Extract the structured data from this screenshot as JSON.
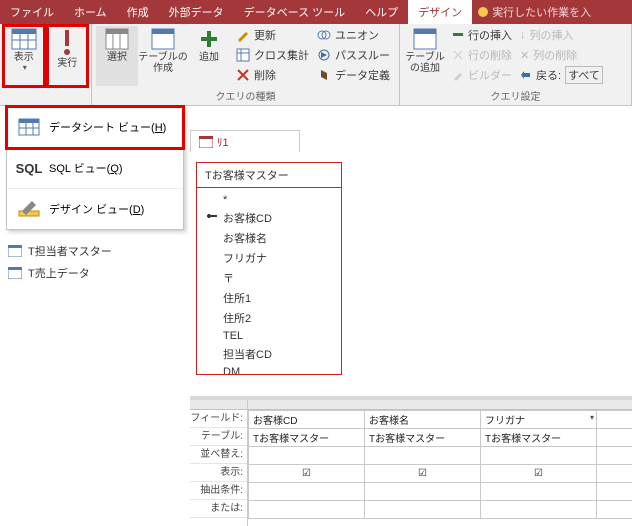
{
  "menu": {
    "file": "ファイル",
    "home": "ホーム",
    "create": "作成",
    "external": "外部データ",
    "dbtools": "データベース ツール",
    "help": "ヘルプ",
    "design": "デザイン",
    "tellme": "実行したい作業を入"
  },
  "ribbon": {
    "view": "表示",
    "run": "実行",
    "select": "選択",
    "maketable": "テーブルの\n作成",
    "append": "追加",
    "update": "更新",
    "crosstab": "クロス集計",
    "delete": "削除",
    "union": "ユニオン",
    "passthrough": "パススルー",
    "datadef": "データ定義",
    "addtable": "テーブル\nの追加",
    "insertrows": "行の挿入",
    "deleterows": "行の削除",
    "builder": "ビルダー",
    "insertcols": "列の挿入",
    "deletecols": "列の削除",
    "return": "戻る:",
    "return_val": "すべて",
    "grp_querytype": "クエリの種類",
    "grp_querysetup": "クエリ設定"
  },
  "dropdown": {
    "datasheet": "データシート ビュー(",
    "datasheet_key": "H",
    "sql_logo": "SQL",
    "sql": "SQL ビュー(",
    "sql_key": "Q",
    "design": "デザイン ビュー(",
    "design_key": "D",
    "close": ")"
  },
  "docTab": "ﾘ1",
  "nav": {
    "t_tanto": "T担当者マスター",
    "t_uriage": "T売上データ"
  },
  "table": {
    "name": "Tお客様マスター",
    "star": "*",
    "fields": [
      "お客様CD",
      "お客様名",
      "フリガナ",
      "〒",
      "住所1",
      "住所2",
      "TEL",
      "担当者CD",
      "DM"
    ]
  },
  "qbe": {
    "labels": {
      "field": "フィールド:",
      "table": "テーブル:",
      "sort": "並べ替え:",
      "show": "表示:",
      "criteria": "抽出条件:",
      "or": "または:"
    },
    "cols": [
      {
        "field": "お客様CD",
        "table": "Tお客様マスター",
        "show": true
      },
      {
        "field": "お客様名",
        "table": "Tお客様マスター",
        "show": true
      },
      {
        "field": "フリガナ",
        "table": "Tお客様マスター",
        "show": true
      }
    ]
  }
}
